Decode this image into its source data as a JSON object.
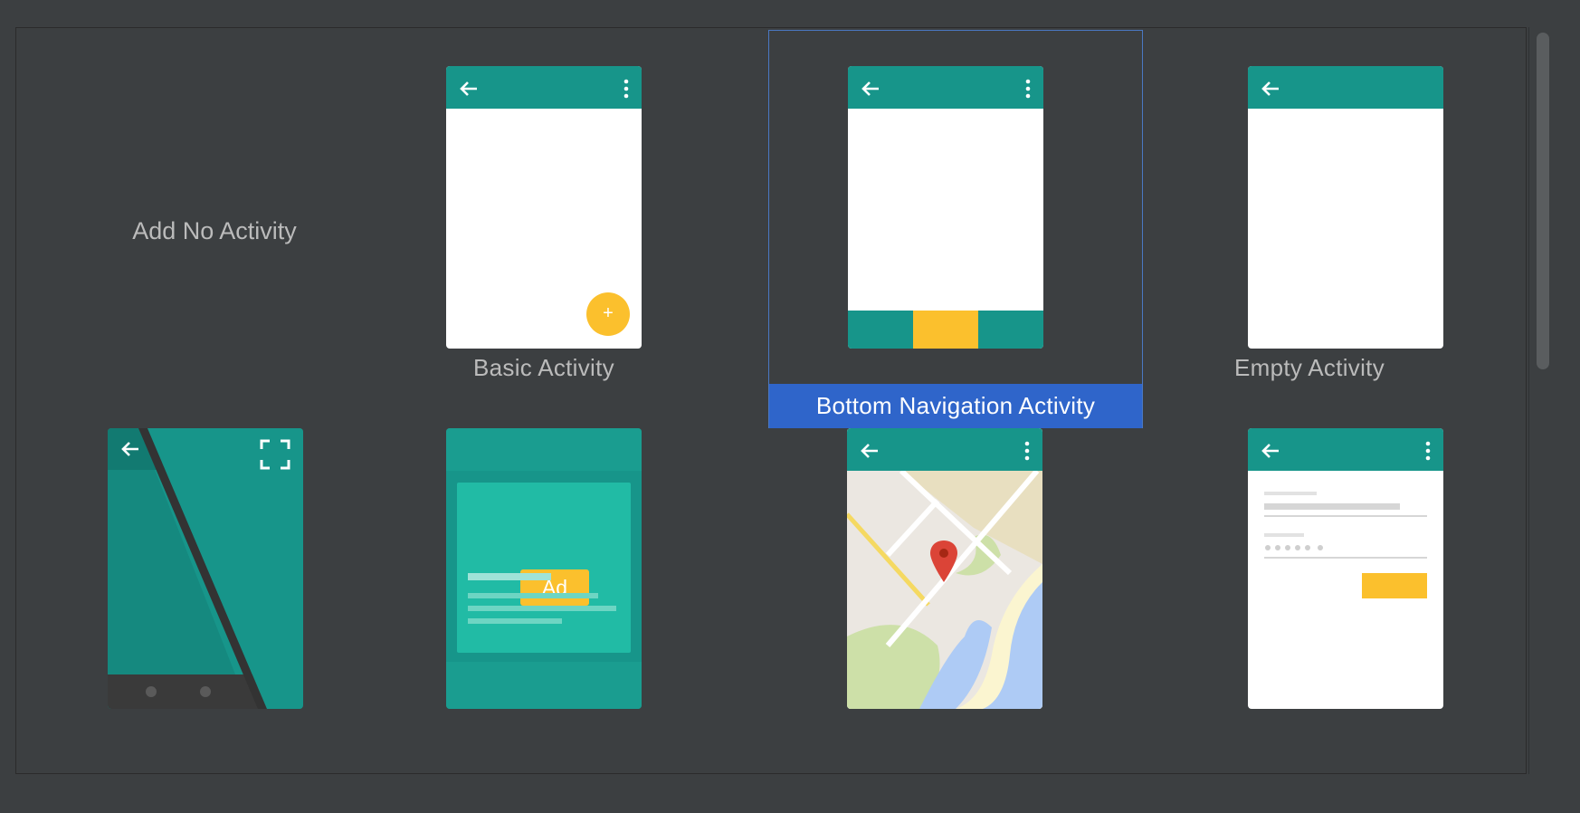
{
  "gallery": {
    "tiles": [
      {
        "label": "Add No Activity"
      },
      {
        "label": "Basic Activity",
        "fab_symbol": "+"
      },
      {
        "label": "Bottom Navigation Activity",
        "selected": true
      },
      {
        "label": "Empty Activity"
      },
      {
        "label": ""
      },
      {
        "label": "",
        "ad_text": "Ad"
      },
      {
        "label": ""
      },
      {
        "label": ""
      }
    ]
  },
  "colors": {
    "background": "#3c3f41",
    "teal": "#17958a",
    "accent_yellow": "#fbc02d",
    "selection_blue": "#2f65ca",
    "label_text": "#bbbbbb"
  }
}
